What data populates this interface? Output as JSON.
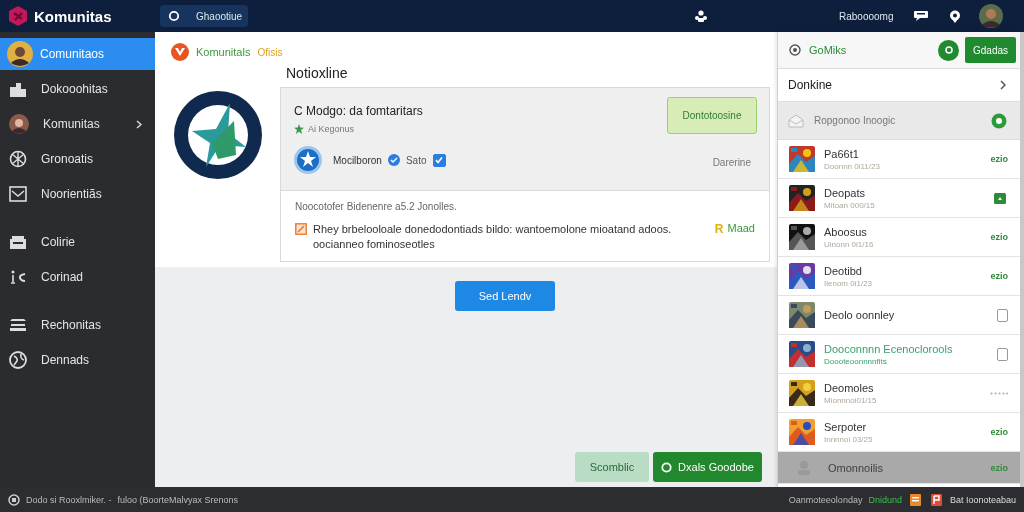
{
  "top_bar": {
    "app_name": "Komunitas",
    "search": {
      "value": "Ghaootiue"
    },
    "user_label": "Raboooomg"
  },
  "sidebar": {
    "groups": [
      [
        {
          "label": "Comunitaos",
          "selected": true,
          "has_submenu": false
        },
        {
          "label": "Dokooohitas",
          "selected": false,
          "has_submenu": false
        },
        {
          "label": "Komunitas",
          "selected": false,
          "has_submenu": true
        },
        {
          "label": "Gronoatis",
          "selected": false,
          "has_submenu": false
        },
        {
          "label": "Noorientiãs",
          "selected": false,
          "has_submenu": false
        }
      ],
      [
        {
          "label": "Colirie",
          "selected": false,
          "has_submenu": false
        },
        {
          "label": "Corinad",
          "selected": false,
          "has_submenu": false
        }
      ],
      [
        {
          "label": "Rechonitas",
          "selected": false,
          "has_submenu": false
        },
        {
          "label": "Dennads",
          "selected": false,
          "has_submenu": false
        }
      ]
    ]
  },
  "main": {
    "breadcrumb": "Komunitals",
    "breadcrumb_tag": "Ofisis",
    "title": "Notioxline",
    "card": {
      "title": "C Modgo: da fomtaritars",
      "subtitle": "Ai Kegonus",
      "user": {
        "name": "Mocilboron",
        "tag": "Sato",
        "checked": true
      },
      "action_button": "Dontotoosine",
      "status": "Darerine",
      "note": "Noocotofer Bidenenre a5.2 Jonolles.",
      "message": "Rhey brbelooloale donedodontiads bildo: wantoemolone mioatand adoos. oocianneo fominoseotles",
      "link_mark": "R",
      "link": "Maad"
    },
    "primary_button": "Sed Lendv",
    "footer_buttons": [
      {
        "label": "Scomblic",
        "kind": "secondary"
      },
      {
        "label": "Dxals Goodobe",
        "kind": "primary"
      }
    ]
  },
  "right_panel": {
    "title": "GoMiks",
    "action_button": "Gdadas",
    "section": "Donkine",
    "filter": "Ropgonoo Inoogic",
    "items": [
      {
        "title": "Pa66t1",
        "subtitle": "Doonnn 0i11/23",
        "kind": "tag",
        "tag": "ezio",
        "highlighted": false,
        "dimmed": false
      },
      {
        "title": "Deopats",
        "subtitle": "Mitoan 000/15",
        "kind": "badge",
        "highlighted": false,
        "dimmed": false
      },
      {
        "title": "Aboosus",
        "subtitle": "Uinonn 0i1/16",
        "kind": "tag",
        "tag": "ezio",
        "highlighted": false,
        "dimmed": false
      },
      {
        "title": "Deotibd",
        "subtitle": "Ilenom 0i1/23",
        "kind": "tag",
        "tag": "ezio",
        "highlighted": false,
        "dimmed": false
      },
      {
        "title": "Deolo oonnley",
        "kind": "checkbox",
        "checked": false,
        "highlighted": false,
        "dimmed": false
      },
      {
        "title": "Dooconnnn Ecenoclorools",
        "subtitle": "Doooteoonnnnfits",
        "kind": "checkbox",
        "checked": false,
        "highlighted": true,
        "dimmed": false
      },
      {
        "title": "Deomoles",
        "subtitle": "Mionnnoi01/15",
        "kind": "dots",
        "highlighted": false,
        "dimmed": false
      },
      {
        "title": "Serpoter",
        "subtitle": "Innnnoi 03/25",
        "kind": "tag",
        "tag": "ezio",
        "highlighted": false,
        "dimmed": false
      },
      {
        "title": "Omonnoilis",
        "kind": "tag",
        "tag": "ezio",
        "highlighted": false,
        "dimmed": true
      }
    ]
  },
  "status_bar": {
    "left": "Dodo si Rooxlmiker. -",
    "left_detail": "fuloo (BoorteMalvyax Srenons",
    "right": "Oanmoteeolonday",
    "right_tag": "Dnidund",
    "right_end": "Bat Ioonoteabau"
  }
}
